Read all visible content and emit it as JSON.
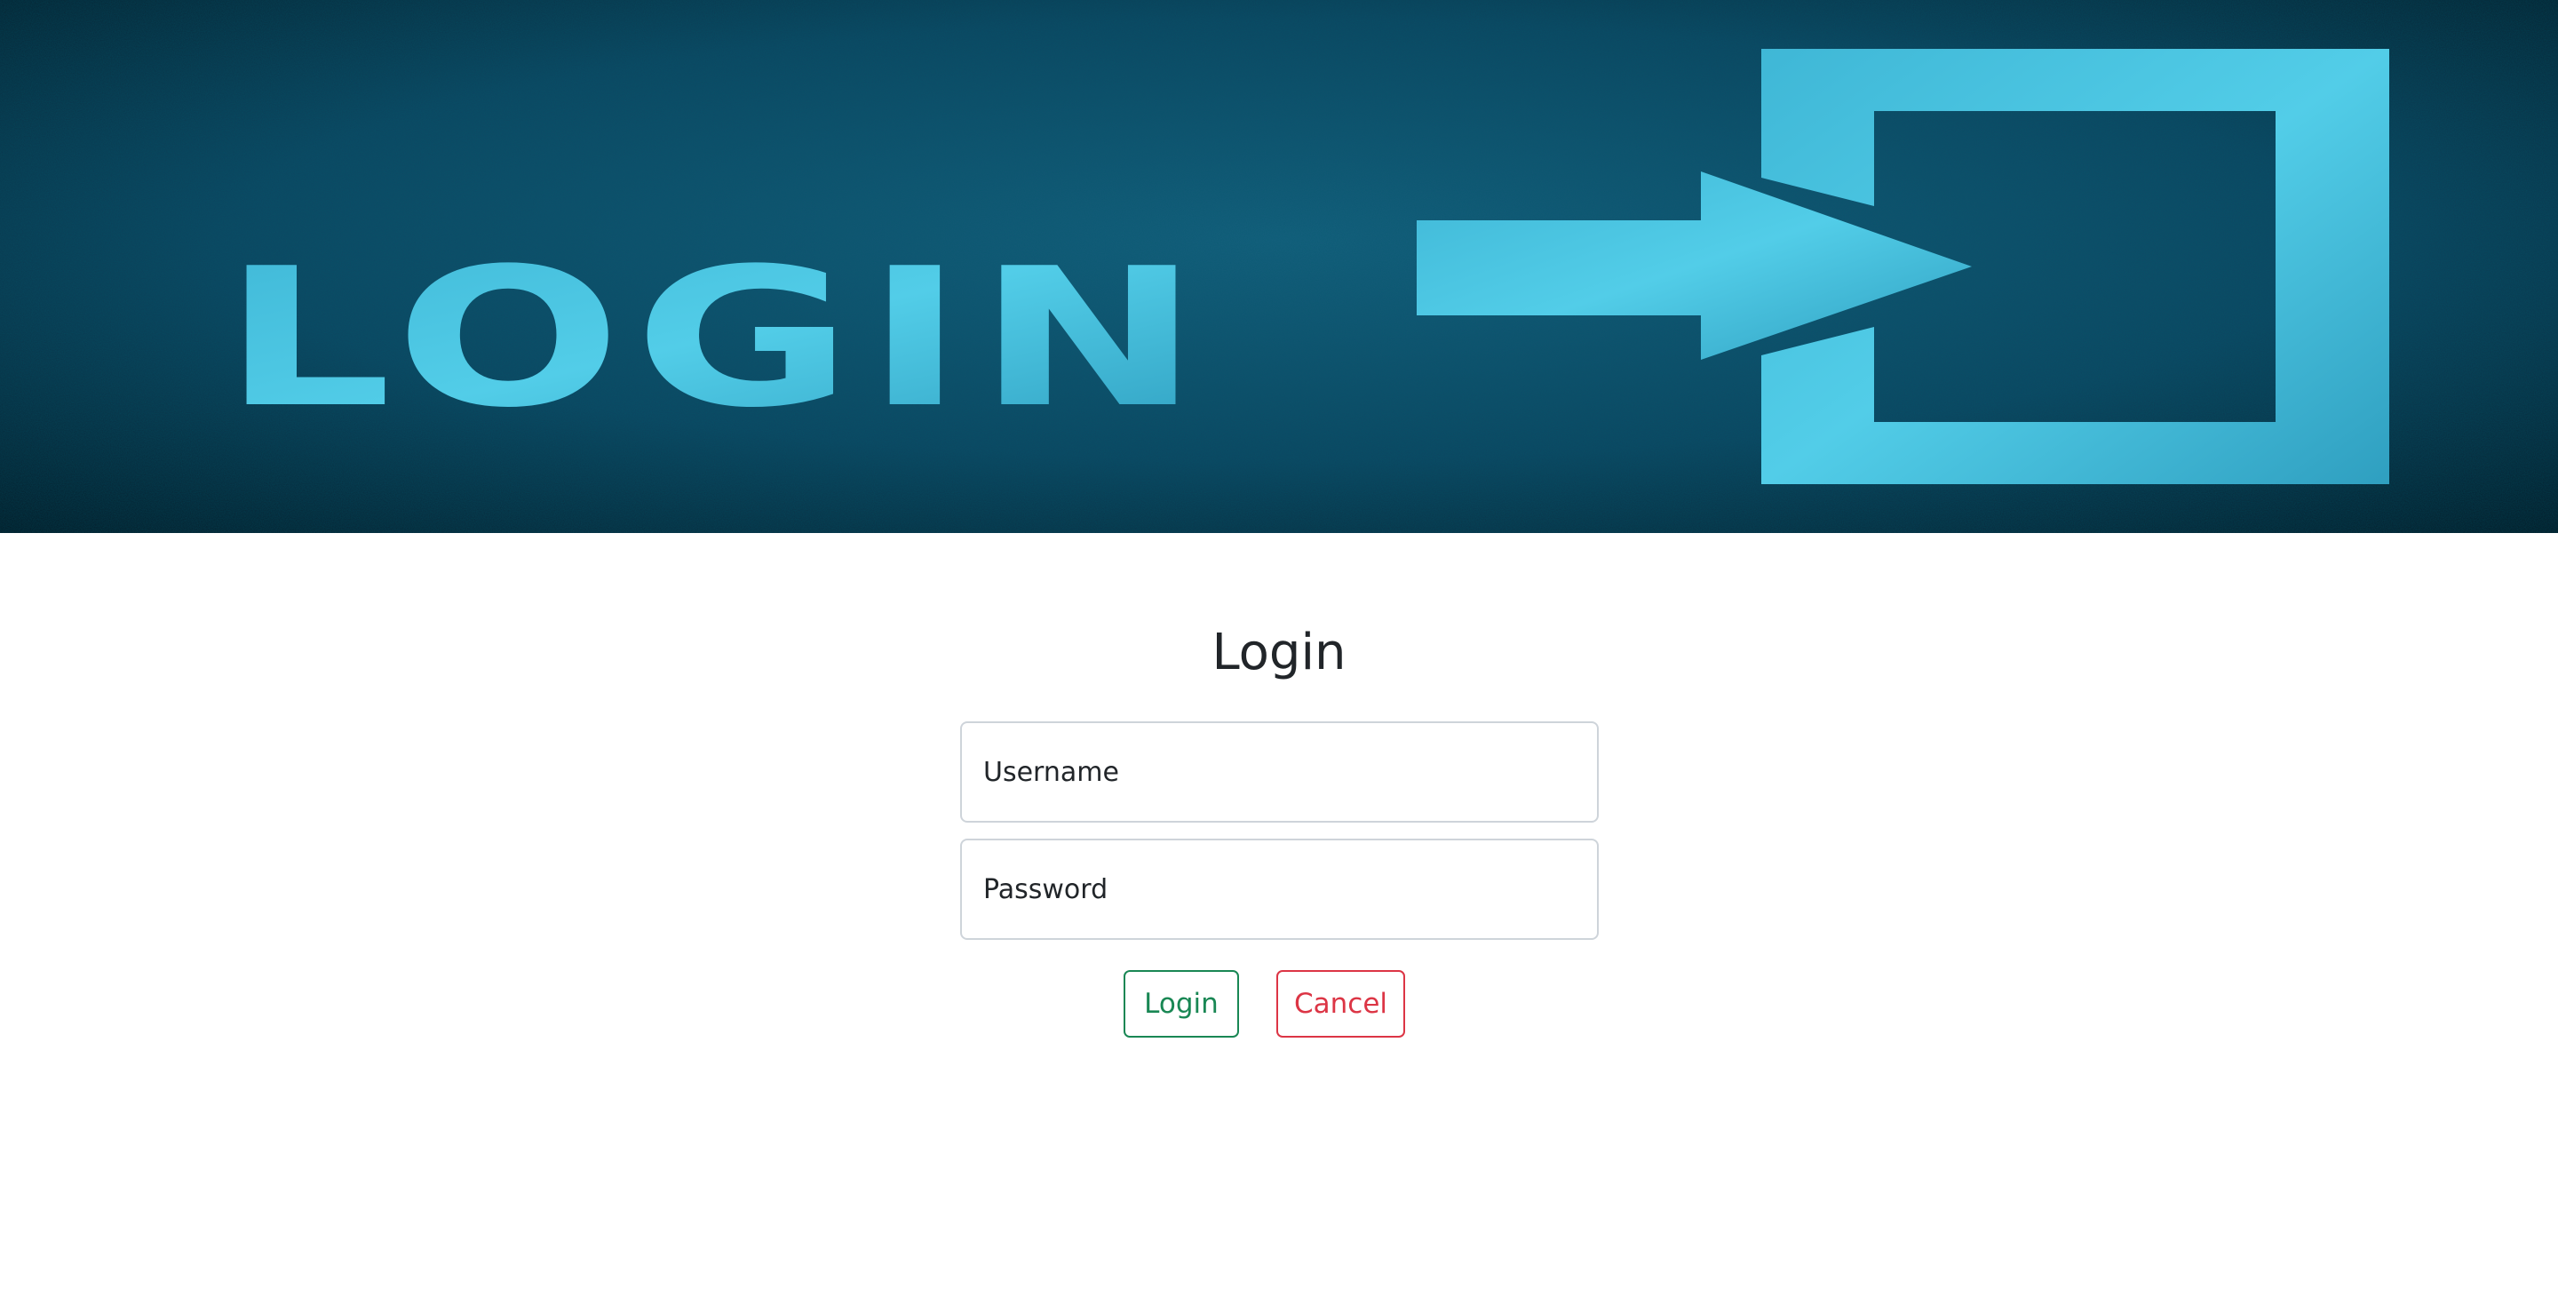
{
  "banner": {
    "word": "LOGIN",
    "colors": {
      "background": "#0b3a4f",
      "accent": "#45c3e0"
    }
  },
  "form": {
    "title": "Login",
    "username_placeholder": "Username",
    "password_placeholder": "Password",
    "login_label": "Login",
    "cancel_label": "Cancel"
  },
  "colors": {
    "success": "#198754",
    "danger": "#dc3545",
    "text": "#212529",
    "border": "#ced4da"
  }
}
